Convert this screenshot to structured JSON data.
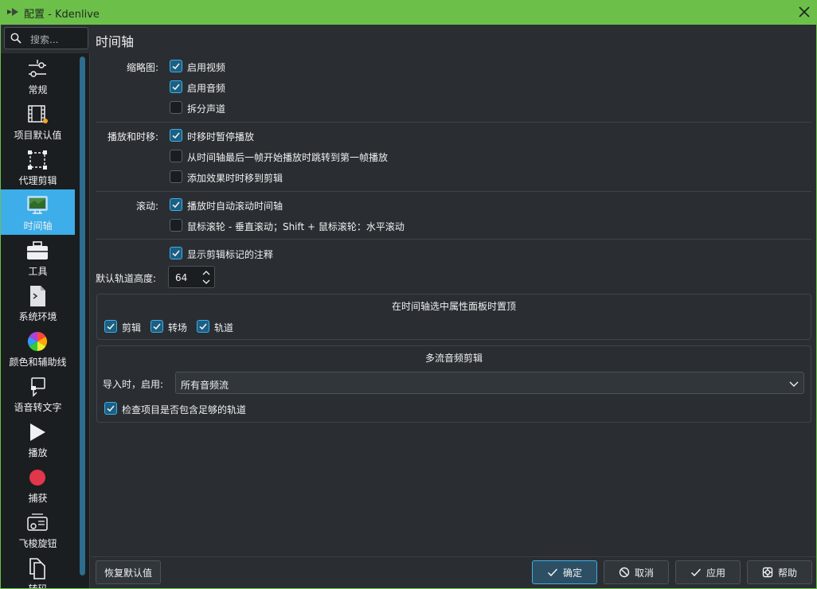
{
  "window": {
    "title": "配置 - Kdenlive"
  },
  "search": {
    "placeholder": "搜索..."
  },
  "page": {
    "title": "时间轴"
  },
  "sidebar": {
    "items": [
      {
        "label": "常规",
        "icon": "sliders-icon"
      },
      {
        "label": "项目默认值",
        "icon": "film-icon"
      },
      {
        "label": "代理剪辑",
        "icon": "proxy-clip-icon"
      },
      {
        "label": "时间轴",
        "icon": "timeline-monitor-icon",
        "active": true
      },
      {
        "label": "工具",
        "icon": "toolbox-icon"
      },
      {
        "label": "系统环境",
        "icon": "terminal-icon"
      },
      {
        "label": "颜色和辅助线",
        "icon": "color-wheel-icon"
      },
      {
        "label": "语音转文字",
        "icon": "speech-icon"
      },
      {
        "label": "播放",
        "icon": "play-icon"
      },
      {
        "label": "捕获",
        "icon": "record-icon"
      },
      {
        "label": "飞梭旋钮",
        "icon": "jog-shuttle-icon"
      },
      {
        "label": "转码",
        "icon": "transcode-icon"
      }
    ]
  },
  "thumbnails": {
    "label": "缩略图:",
    "options": [
      {
        "label": "启用视频",
        "checked": true
      },
      {
        "label": "启用音频",
        "checked": true
      },
      {
        "label": "拆分声道",
        "checked": false
      }
    ]
  },
  "playback": {
    "label": "播放和时移:",
    "options": [
      {
        "label": "时移时暂停播放",
        "checked": true
      },
      {
        "label": "从时间轴最后一帧开始播放时跳转到第一帧播放",
        "checked": false
      },
      {
        "label": "添加效果时时移到剪辑",
        "checked": false
      }
    ]
  },
  "scroll": {
    "label": "滚动:",
    "options": [
      {
        "label": "播放时自动滚动时间轴",
        "checked": true
      },
      {
        "label": "鼠标滚轮 - 垂直滚动；Shift + 鼠标滚轮：水平滚动",
        "checked": false
      }
    ]
  },
  "markers": {
    "label": "显示剪辑标记的注释",
    "checked": true
  },
  "track_height": {
    "label": "默认轨道高度:",
    "value": "64"
  },
  "raise_group": {
    "title": "在时间轴选中属性面板时置顶",
    "options": [
      {
        "label": "剪辑",
        "checked": true
      },
      {
        "label": "转场",
        "checked": true
      },
      {
        "label": "轨道",
        "checked": true
      }
    ]
  },
  "multistream": {
    "title": "多流音频剪辑",
    "import_label": "导入时，启用:",
    "import_value": "所有音频流",
    "check_label": "检查项目是否包含足够的轨道",
    "check_checked": true
  },
  "footer": {
    "restore": "恢复默认值",
    "ok": "确定",
    "cancel": "取消",
    "apply": "应用",
    "help": "帮助"
  },
  "colors": {
    "accent": "#3daee9",
    "titlebar": "#6cc04a",
    "background": "#2a2e32"
  }
}
